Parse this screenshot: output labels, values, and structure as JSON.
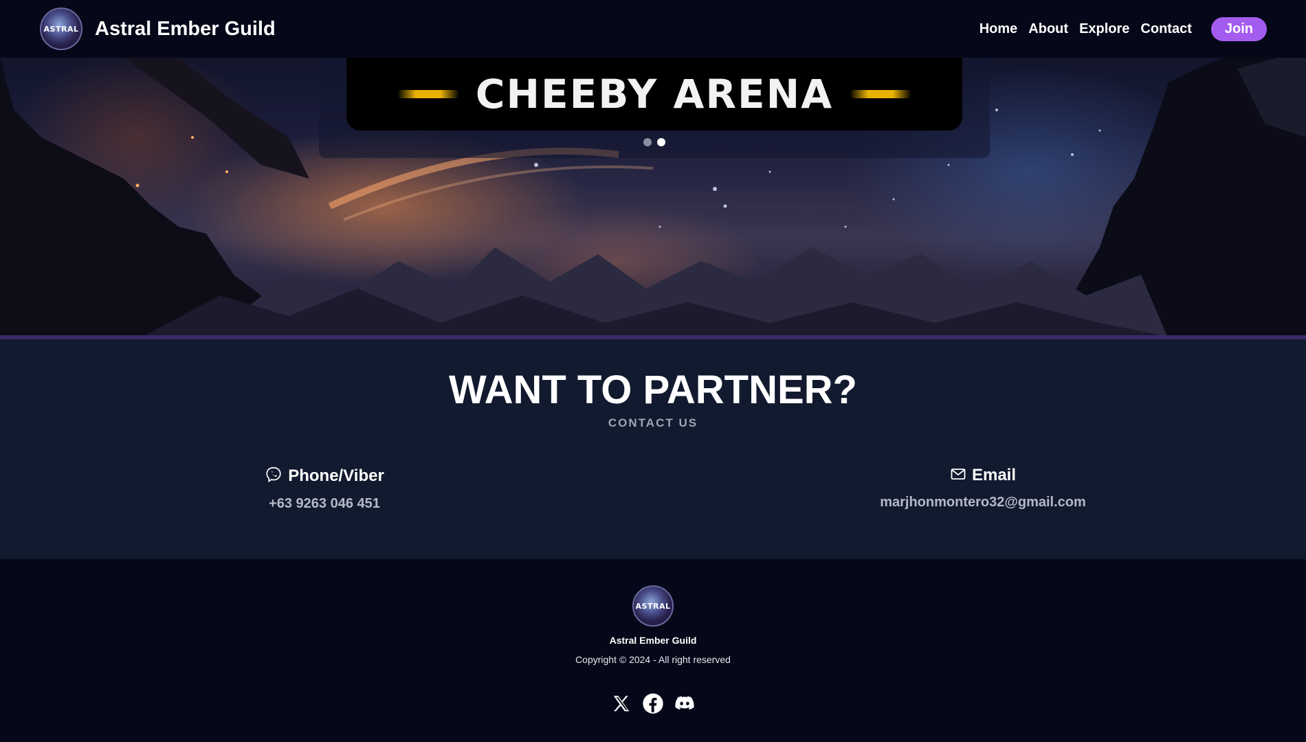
{
  "header": {
    "brand_name": "Astral Ember Guild",
    "logo_text": "ASTRAL",
    "nav": [
      "Home",
      "About",
      "Explore",
      "Contact"
    ],
    "join_label": "Join"
  },
  "carousel": {
    "slide_title": "CHEEBY ARENA",
    "slide_count": 2,
    "active_index": 1
  },
  "partner": {
    "title": "WANT TO PARTNER?",
    "subtitle": "CONTACT US",
    "phone": {
      "label": "Phone/Viber",
      "value": "+63 9263 046 451",
      "icon": "viber-phone-icon"
    },
    "email": {
      "label": "Email",
      "value": "marjhonmontero32@gmail.com",
      "icon": "mail-icon"
    }
  },
  "footer": {
    "logo_text": "ASTRAL",
    "name": "Astral Ember Guild",
    "copyright": "Copyright © 2024 - All right reserved",
    "socials": [
      "x-icon",
      "facebook-icon",
      "discord-icon"
    ]
  },
  "colors": {
    "accent": "#a45cf0",
    "nav_bg": "#050818",
    "section_bg": "#111a2e",
    "gold": "#e8b200"
  }
}
